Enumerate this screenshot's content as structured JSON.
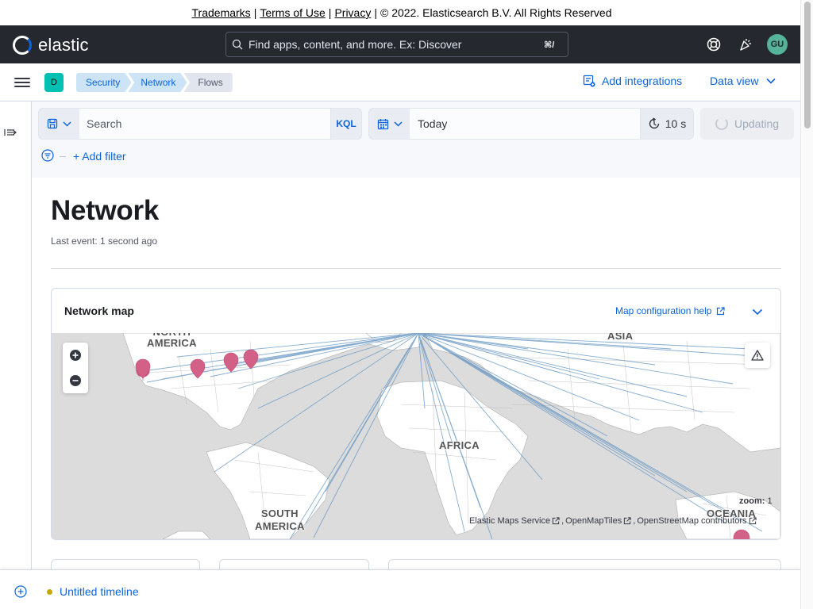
{
  "legal": {
    "trademarks": "Trademarks",
    "terms": "Terms of Use",
    "privacy": "Privacy",
    "copyright": "© 2022. Elasticsearch B.V. All Rights Reserved",
    "sep": "|"
  },
  "header": {
    "logo_text": "elastic",
    "search_placeholder": "Find apps, content, and more. Ex: Discover",
    "search_shortcut": "⌘/",
    "avatar_initials": "GU"
  },
  "subheader": {
    "space_initial": "D",
    "breadcrumbs": [
      "Security",
      "Network",
      "Flows"
    ],
    "add_integrations": "Add integrations",
    "data_view": "Data view"
  },
  "query": {
    "search_placeholder": "Search",
    "language": "KQL",
    "date_range": "Today",
    "refresh_interval": "10 s",
    "update_label": "Updating",
    "add_filter": "+ Add filter"
  },
  "page": {
    "title": "Network",
    "last_event": "Last event: 1 second ago"
  },
  "map_panel": {
    "title": "Network map",
    "config_help": "Map configuration help",
    "zoom_label": "zoom:",
    "zoom_value": "1",
    "labels": {
      "north_america": "NORTH\nAMERICA",
      "south_america": "SOUTH\nAMERICA",
      "africa": "AFRICA",
      "asia": "ASIA",
      "oceania": "OCEANIA"
    },
    "attribution": [
      "Elastic Maps Service",
      "OpenMapTiles",
      "OpenStreetMap contributors"
    ],
    "line_color": "#6092c0",
    "marker_color": "#d36086"
  },
  "timeline": {
    "name": "Untitled timeline"
  },
  "colors": {
    "header_bg": "#25282f",
    "accent": "#0b64dd",
    "space_badge": "#00bfb3",
    "avatar": "#54b399"
  }
}
